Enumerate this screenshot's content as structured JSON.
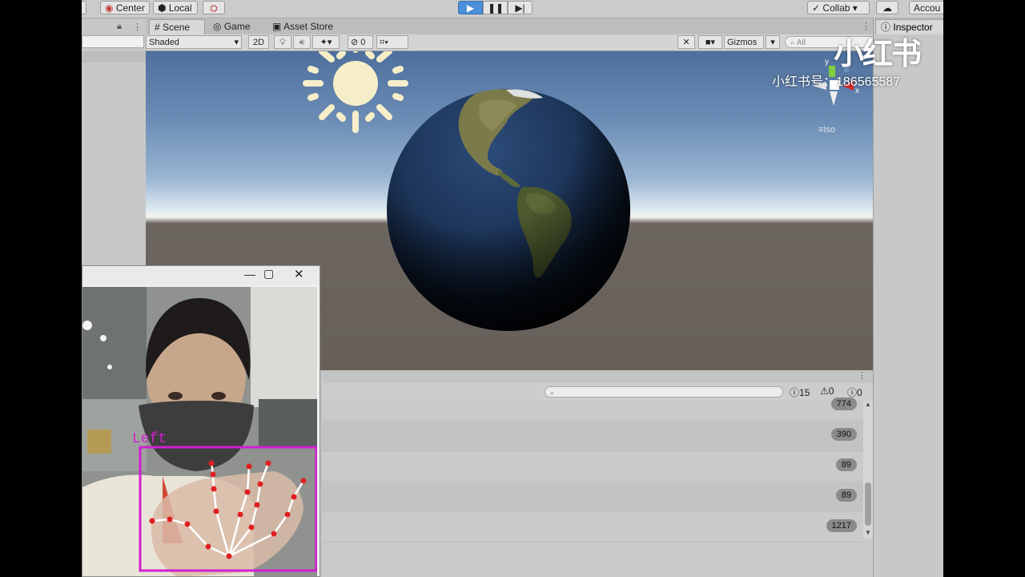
{
  "toolbar": {
    "center_label": "Center",
    "local_label": "Local",
    "collab_label": "Collab ▾",
    "account_label": "Accou"
  },
  "tabs": {
    "scene": "Scene",
    "game": "Game",
    "asset_store": "Asset Store",
    "inspector": "Inspector"
  },
  "scene_toolbar": {
    "shading_mode": "Shaded",
    "mode_2d": "2D",
    "hidden_count": "0",
    "gizmos_label": "Gizmos",
    "search_placeholder": "All"
  },
  "gizmo": {
    "y_label": "y",
    "x_label": "x",
    "projection": "Iso"
  },
  "console": {
    "error_count": "15",
    "warning_count": "0",
    "info_count": "0",
    "rows": [
      {
        "count": "774"
      },
      {
        "count": "390"
      },
      {
        "count": "89"
      },
      {
        "count": "89"
      },
      {
        "count": "1217"
      }
    ]
  },
  "webcam": {
    "hand_label": "Left",
    "hand_color": "#d21fd0"
  },
  "watermark": {
    "logo": "小红书",
    "id_label": "小红书号：",
    "id_value": "186565587"
  },
  "colors": {
    "play_active": "#4a8fd9",
    "sun": "#f6eec9",
    "hand_landmark": "#e02020",
    "hand_bone": "#ffffff"
  }
}
